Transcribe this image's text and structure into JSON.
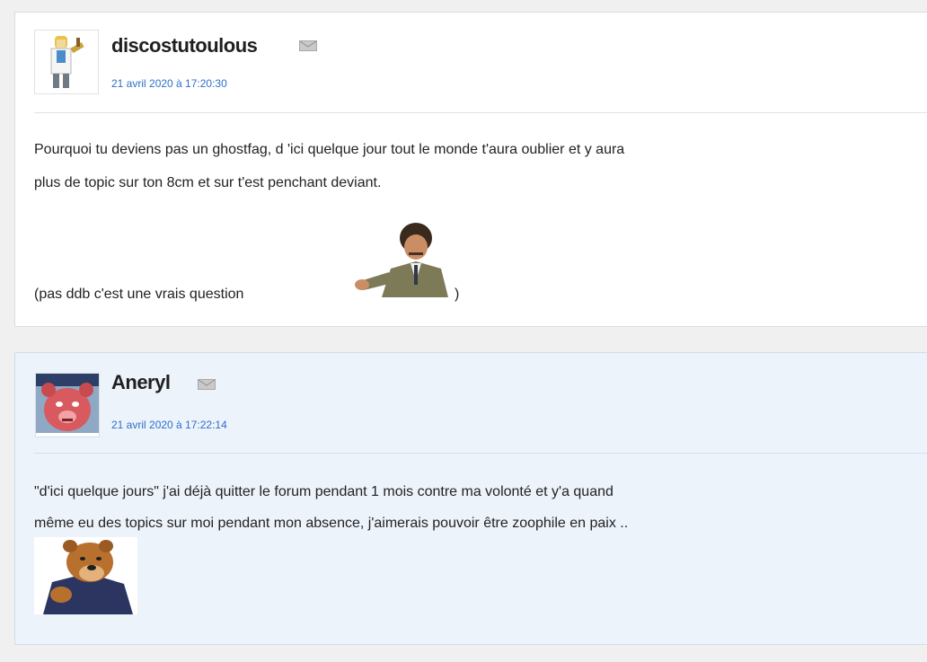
{
  "posts": [
    {
      "username": "discostutoulous",
      "date": "21 avril 2020 à 17:20:30",
      "lines": [
        "Pourquoi tu deviens pas un ghostfag, d 'ici quelque jour tout le monde t'aura oublier et y aura",
        "plus de topic sur ton 8cm et sur t'est penchant deviant.",
        "(pas ddb c'est une vrais question"
      ],
      "closing": ")"
    },
    {
      "username": "Aneryl",
      "date": "21 avril 2020 à 17:22:14",
      "lines": [
        "\"d'ici quelque jours\" j'ai déjà quitter le forum pendant 1 mois contre ma volonté et y'a quand",
        "même eu des topics sur moi pendant mon absence, j'aimerais pouvoir être zoophile en paix .."
      ]
    }
  ],
  "icons": {
    "mail": "envelope-icon",
    "avatar_1": "scientist-avatar",
    "avatar_2": "red-bear-avatar",
    "sticker_1": "man-pointing-sticker",
    "sticker_2": "bear-sticker"
  },
  "colors": {
    "link": "#2e6fc9",
    "post_alt_background": "#edf3fb"
  }
}
